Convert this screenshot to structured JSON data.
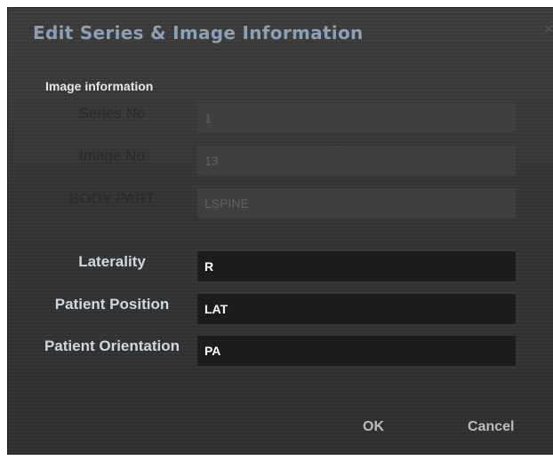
{
  "dialog": {
    "title": "Edit Series & Image Information",
    "close_label": "×"
  },
  "section": {
    "title": "Image information"
  },
  "fields": {
    "series_no": {
      "label": "Series No",
      "value": "1"
    },
    "image_no": {
      "label": "Image No",
      "value": "13"
    },
    "body_part": {
      "label": "BODY PART",
      "value": "LSPINE"
    },
    "laterality": {
      "label": "Laterality",
      "value": "R"
    },
    "patient_position": {
      "label": "Patient Position",
      "value": "LAT"
    },
    "patient_orientation": {
      "label": "Patient Orientation",
      "value": "PA"
    }
  },
  "buttons": {
    "ok": "OK",
    "cancel": "Cancel"
  }
}
